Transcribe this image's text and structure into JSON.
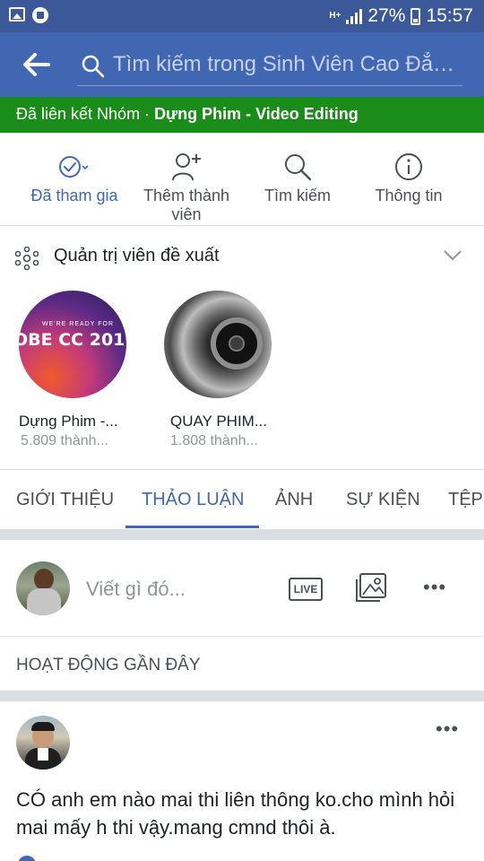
{
  "status_bar": {
    "network": "H+",
    "battery": "27%",
    "time": "15:57"
  },
  "header": {
    "search_placeholder": "Tìm kiếm trong Sinh Viên Cao Đẳn..."
  },
  "linked_bar": {
    "prefix": "Đã liên kết Nhóm · ",
    "group_name": "Dựng Phim - Video Editing"
  },
  "actions": [
    {
      "label": "Đã tham gia",
      "icon": "check-circle-icon"
    },
    {
      "label": "Thêm thành viên",
      "icon": "add-person-icon"
    },
    {
      "label": "Tìm kiếm",
      "icon": "search-icon"
    },
    {
      "label": "Thông tin",
      "icon": "info-icon"
    }
  ],
  "admin_suggestions": {
    "title": "Quản trị viên đề xuất",
    "groups": [
      {
        "name": "Dựng Phim -...",
        "members": "5.809 thành...",
        "cover_text_small": "WE'RE READY FOR",
        "cover_text": "OBE CC 201"
      },
      {
        "name": "QUAY PHIM...",
        "members": "1.808 thành..."
      }
    ]
  },
  "tabs": [
    "GIỚI THIỆU",
    "THẢO LUẬN",
    "ẢNH",
    "SỰ KIỆN",
    "TỆP"
  ],
  "active_tab": "THẢO LUẬN",
  "composer": {
    "placeholder": "Viết gì đó...",
    "live_label": "LIVE",
    "more": "•••"
  },
  "recent_activity": {
    "title": "HOẠT ĐỘNG GẦN ĐÂY"
  },
  "post": {
    "text": "CÓ anh em nào mai thi liên thông ko.cho mình hỏi mai mấy h thi vậy.mang cmnd thôi à.",
    "more": "•••"
  },
  "colors": {
    "facebook_blue": "#4267b2",
    "status_blue": "#3b5998",
    "linked_green": "#198c19"
  }
}
